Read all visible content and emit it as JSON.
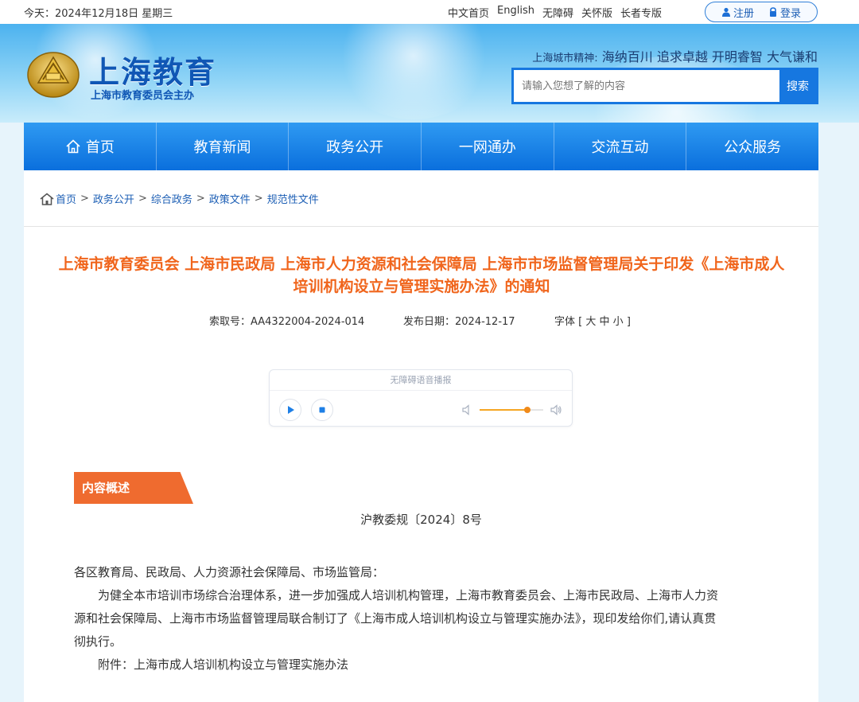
{
  "topbar": {
    "date": "今天：2024年12月18日 星期三",
    "links": [
      "中文首页",
      "English",
      "无障碍",
      "关怀版",
      "长者专版"
    ],
    "register": "注册",
    "login": "登录"
  },
  "header": {
    "logo_title": "上海教育",
    "logo_sub": "上海市教育委员会主办",
    "motto_label": "上海城市精神:",
    "motto_text": "海纳百川 追求卓越 开明睿智 大气谦和",
    "search_placeholder": "请输入您想了解的内容",
    "search_button": "搜索"
  },
  "nav": {
    "items": [
      "首页",
      "教育新闻",
      "政务公开",
      "一网通办",
      "交流互动",
      "公众服务"
    ]
  },
  "breadcrumb": [
    "首页",
    "政务公开",
    "综合政务",
    "政策文件",
    "规范性文件"
  ],
  "article": {
    "title_line1": "上海市教育委员会 上海市民政局 上海市人力资源和社会保障局 上海市市场监督管理局关于印发《上海市成人",
    "title_line2": "培训机构设立与管理实施办法》的通知",
    "index_no": "索取号：AA4322004-2024-014",
    "publish_date": "发布日期：2024-12-17",
    "font_label": "字体 [",
    "font_large": "大",
    "font_medium": "中",
    "font_small": "小",
    "font_close": "]"
  },
  "player": {
    "title": "无障碍语音播报",
    "volume": 0.75
  },
  "content": {
    "section_label": "内容概述",
    "doc_number": "沪教委规〔2024〕8号",
    "salutation": "各区教育局、民政局、人力资源社会保障局、市场监管局：",
    "para1_line1": "为健全本市培训市场综合治理体系，进一步加强成人培训机构管理，上海市教育委员会、上海市民政局、上海市人力资",
    "para1_line2": "源和社会保障局、上海市市场监督管理局联合制订了《上海市成人培训机构设立与管理实施办法》，现印发给你们,请认真贯",
    "para1_line3": "彻执行。",
    "attachment": "附件：上海市成人培训机构设立与管理实施办法"
  },
  "colors": {
    "brand_blue": "#1677e0",
    "title_orange": "#f0651c",
    "section_orange": "#ef6b2f"
  }
}
